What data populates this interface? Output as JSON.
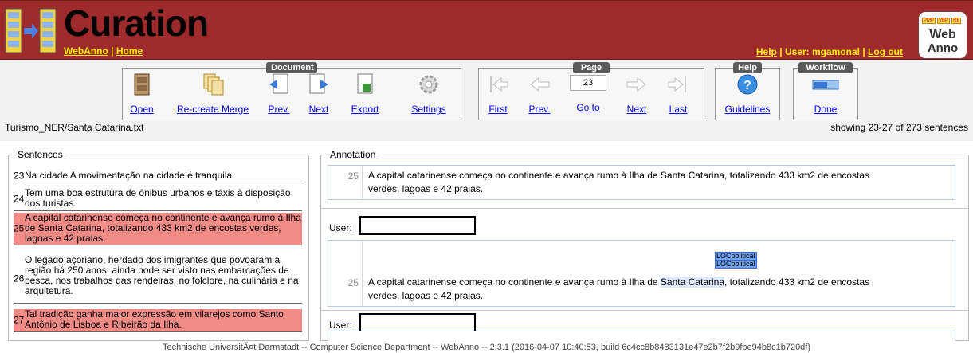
{
  "header": {
    "title": "Curation",
    "brand_link": "WebAnno",
    "home_link": "Home",
    "help_link": "Help",
    "user_text": "User: mgamonal",
    "logout_link": "Log out",
    "badge_tags": [
      "PMP",
      "VBP",
      "RB"
    ],
    "badge_word1": "Web",
    "badge_word2": "Anno"
  },
  "toolbar": {
    "document_title": "Document",
    "page_title": "Page",
    "help_title": "Help",
    "workflow_title": "Workflow",
    "open": "Open",
    "recreate_merge": "Re-create Merge",
    "prev": "Prev.",
    "next": "Next",
    "export": "Export",
    "settings": "Settings",
    "first": "First",
    "page_prev": "Prev.",
    "goto": "Go to",
    "page_next": "Next",
    "last": "Last",
    "page_value": "23",
    "guidelines": "Guidelines",
    "done": "Done"
  },
  "status": {
    "filename": "Turismo_NER/Santa Catarina.txt",
    "showing": "showing 23-27 of 273 sentences"
  },
  "sentences": {
    "legend": "Sentences",
    "items": [
      {
        "num": "23",
        "text": "Na cidade A movimentação na cidade é tranquila."
      },
      {
        "num": "24",
        "text": "Tem uma boa estrutura de ônibus urbanos e táxis à disposição dos turistas."
      },
      {
        "num": "25",
        "text": "A capital catarinense começa no continente e avança rumo à Ilha de Santa Catarina, totalizando 433 km2 de encostas verdes, lagoas e 42 praias."
      },
      {
        "num": "26",
        "text": "O legado açoriano, herdado dos imigrantes que povoaram a região há 250 anos, ainda pode ser visto nas embarcações de pesca, nos trabalhos das rendeiras, no folclore, na culinária e na arquitetura."
      },
      {
        "num": "27",
        "text": "Tal tradição ganha maior expressão em vilarejos como Santo Antônio de Lisboa e Ribeirão da Ilha."
      }
    ]
  },
  "annotation": {
    "legend": "Annotation",
    "line_num": "25",
    "line1": "A capital catarinense começa no continente e avança rumo à Ilha de Santa Catarina, totalizando 433 km2 de encostas",
    "line2": "verdes, lagoas e 42 praias.",
    "user_label": "User:",
    "user_line1_pre": "A capital catarinense começa no continente e avança rumo à Ilha de ",
    "user_entity": "Santa Catarina",
    "user_line1_post": ", totalizando 433 km2 de encostas",
    "span_label1": "LOCpolitical",
    "span_label2": "LOCpolitical"
  },
  "footer": {
    "text": "Technische UniversitÃ¤t Darmstadt -- Computer Science Department -- WebAnno -- 2.3.1 (2016-04-07 10:40:53, build 6c4cc8b8483131e47e2b7f2b9fbe94b8c1b720df)"
  }
}
